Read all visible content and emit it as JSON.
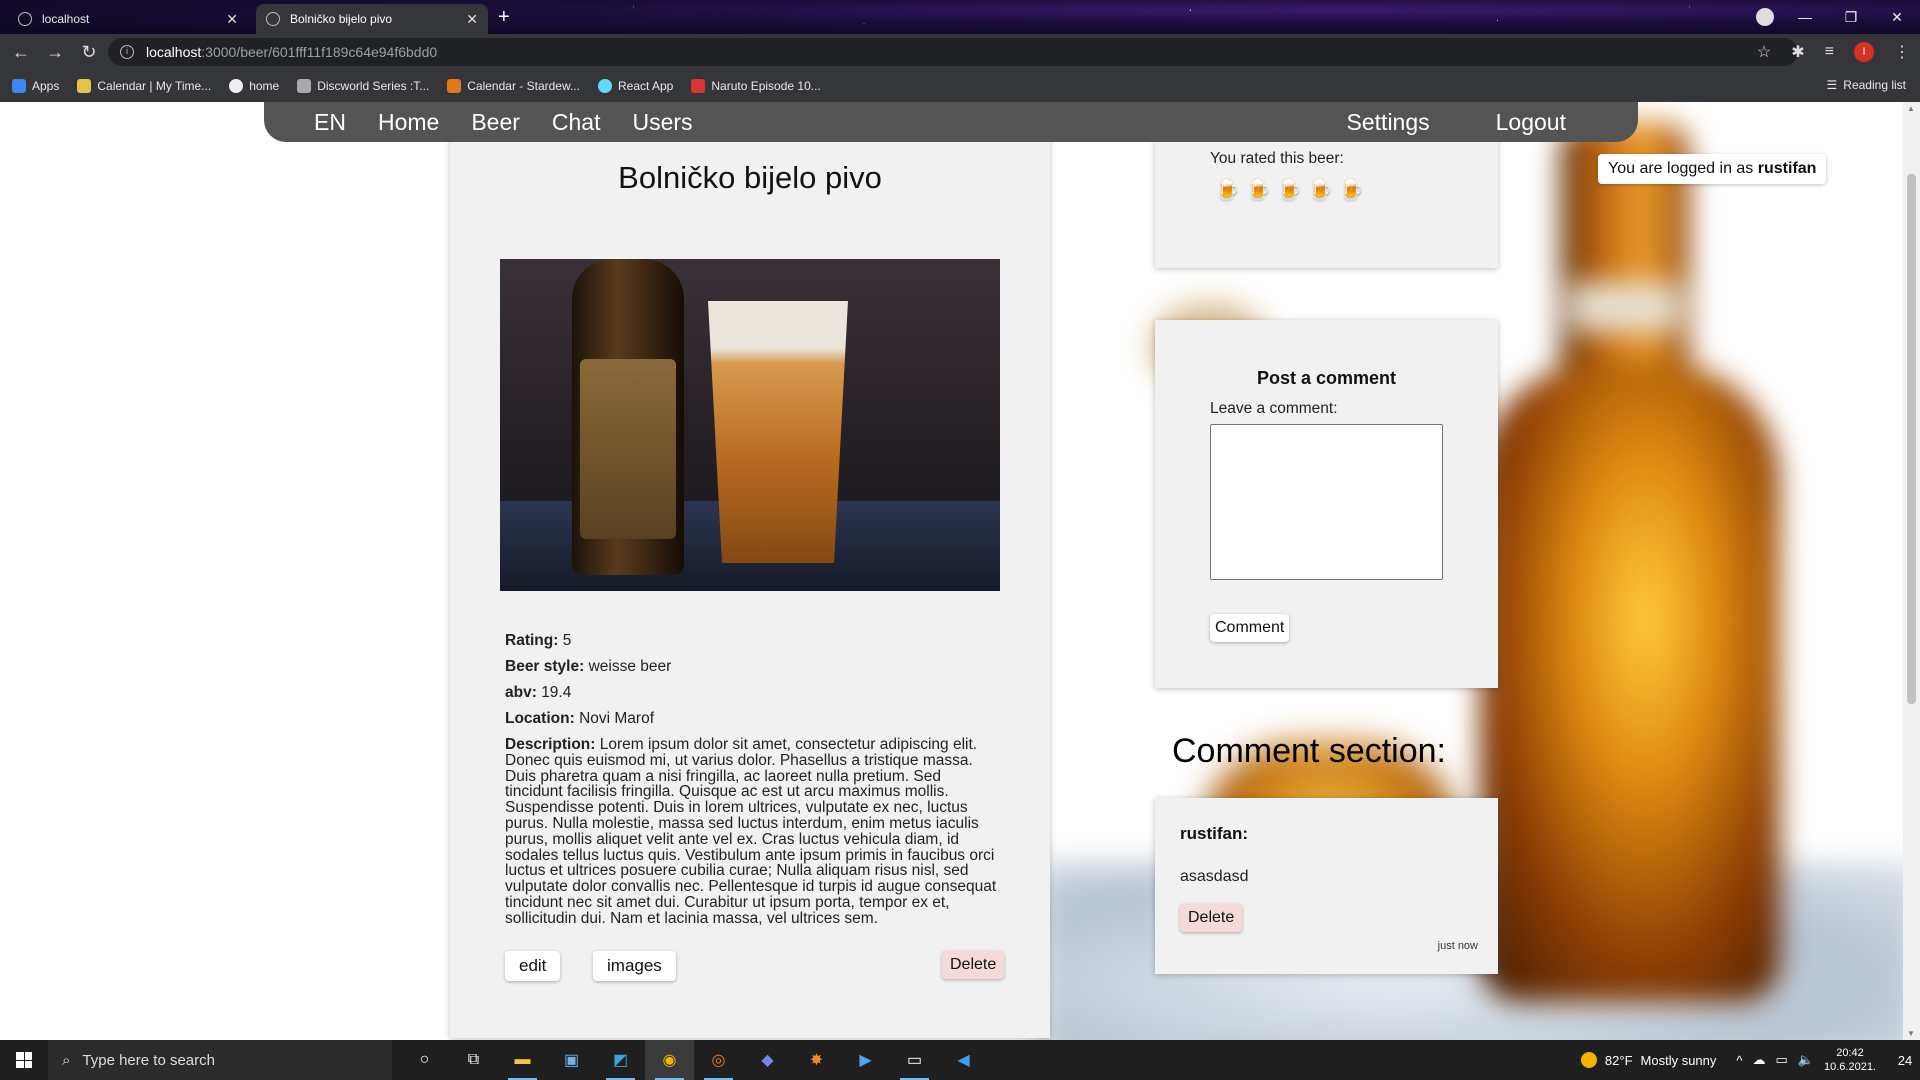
{
  "browser": {
    "tabs": [
      {
        "title": "localhost",
        "active": false
      },
      {
        "title": "Bolničko bijelo pivo",
        "active": true
      }
    ],
    "url_host": "localhost",
    "url_path": ":3000/beer/601fff11f189c64e94f6bdd0",
    "profile_initial": "I",
    "bookmarks": [
      "Apps",
      "Calendar | My Time...",
      "home",
      "Discworld Series :T...",
      "Calendar - Stardew...",
      "React App",
      "Naruto Episode 10..."
    ],
    "reading_list": "Reading list"
  },
  "nav": {
    "lang": "EN",
    "home": "Home",
    "beer": "Beer",
    "chat": "Chat",
    "users": "Users",
    "settings": "Settings",
    "logout": "Logout"
  },
  "login": {
    "prefix": "You are logged in as",
    "username": "rustifan"
  },
  "beer": {
    "title": "Bolničko bijelo pivo",
    "rating_label": "Rating:",
    "rating": "5",
    "style_label": "Beer style:",
    "style": "weisse beer",
    "abv_label": "abv:",
    "abv": "19.4",
    "location_label": "Location:",
    "location": "Novi Marof",
    "description_label": "Description:",
    "description": "Lorem ipsum dolor sit amet, consectetur adipiscing elit. Donec quis euismod mi, ut varius dolor. Phasellus a tristique massa. Duis pharetra quam a nisi fringilla, ac laoreet nulla pretium. Sed tincidunt facilisis fringilla. Quisque ac est ut arcu maximus mollis. Suspendisse potenti. Duis in lorem ultrices, vulputate ex nec, luctus purus. Nulla molestie, massa sed luctus interdum, enim metus iaculis purus, mollis aliquet velit ante vel ex. Cras luctus vehicula diam, id sodales tellus luctus quis. Vestibulum ante ipsum primis in faucibus orci luctus et ultrices posuere cubilia curae; Nulla aliquam risus nisl, sed vulputate dolor convallis nec. Pellentesque id turpis id augue consequat tincidunt nec sit amet dui. Curabitur ut ipsum porta, tempor ex et, sollicitudin dui. Nam et lacinia massa, vel ultrices sem.",
    "edit_label": "edit",
    "images_label": "images",
    "delete_label": "Delete"
  },
  "rating_box": {
    "label": "You rated this beer:",
    "user_rating": 5,
    "max_rating": 5
  },
  "post_comment": {
    "title": "Post a comment",
    "label": "Leave a comment:",
    "value": "",
    "button": "Comment"
  },
  "comment_section": {
    "title": "Comment section:",
    "comments": [
      {
        "user": "rustifan:",
        "text": "asasdasd",
        "delete_label": "Delete",
        "time": "just now"
      }
    ]
  },
  "taskbar": {
    "search_placeholder": "Type here to search",
    "weather_temp": "82°F",
    "weather_desc": "Mostly sunny",
    "time": "20:42",
    "date": "10.6.2021.",
    "notification_count": "24"
  },
  "colors": {
    "nav_bg": "#545454",
    "card_bg": "#f1f1f1",
    "delete_bg": "#f6d9d9"
  }
}
